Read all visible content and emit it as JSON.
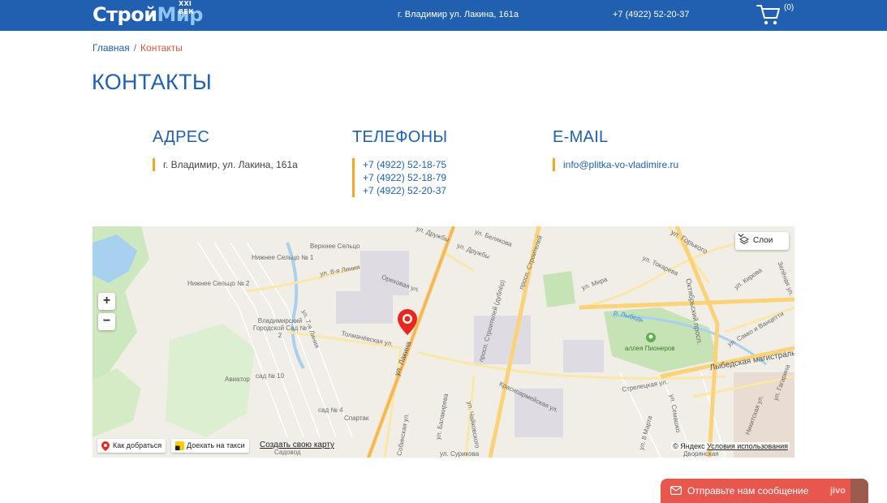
{
  "header": {
    "logo_part1": "Строй",
    "logo_part2": "Мир",
    "logo_sup": "XXI ВЕК",
    "address": "г. Владимир ул. Лакина, 161а",
    "phone": "+7 (4922) 52-20-37",
    "cart_count": "(0)"
  },
  "breadcrumb": {
    "home": "Главная",
    "separator": "/",
    "current": "Контакты"
  },
  "page_title": "КОНТАКТЫ",
  "contacts": {
    "address": {
      "title": "АДРЕС",
      "text": "г. Владимир,  ул. Лакина, 161а"
    },
    "phones": {
      "title": "ТЕЛЕФОНЫ",
      "items": [
        "+7 (4922) 52-18-75",
        "+7 (4922) 52-18-79",
        "+7 (4922) 52-20-37"
      ]
    },
    "email": {
      "title": "E-MAIL",
      "value": "info@plitka-vo-vladimire.ru"
    }
  },
  "map": {
    "layers_label": "Слои",
    "route_label": "Как добраться",
    "taxi_label": "Доехать на такси",
    "create_map_label": "Создать свою карту",
    "copyright": "© Яндекс",
    "terms": "Условия использования",
    "zoom_in": "+",
    "zoom_out": "−",
    "labels": {
      "verkhnee": "Верхнее Сельцо",
      "nizhnee1": "Нижнее Сельцо № 1",
      "nizhnee2": "Нижнее Сельцо № 2",
      "liniya8": "ул. 8-я Линия",
      "orekhovaya": "Ореховая ул.",
      "druzhby1": "ул. Дружбы",
      "druzhby2": "ул. Дружбы",
      "belyakova": "ул. Белякова",
      "stroiteley": "просп. Строителей",
      "stroiteley_dubler": "просп. Строителей (дублёр)",
      "gorkogo": "ул. Горького",
      "tokareva": "ул. Токарева",
      "oktyabrsky": "Октябрьский просп.",
      "kirova": "ул. Кирова",
      "zelenaya": "Зелёная ул.",
      "mira": "ул. Мира",
      "lybed": "р. Лыбедь",
      "pionerov": "аллея Пионеров",
      "sakko": "ул. Сакко и Ванцетти",
      "lybedskaya": "Лыбедская магистраль",
      "gorodskoy": "Владимирский Городской Сад № 2",
      "liniya7": "ул. 7-я Линия",
      "tolmachevskaya": "Толмачёвская ул.",
      "lakina": "ул. Лакина",
      "aviator": "Авиатор",
      "sad10": "сад № 10",
      "sad4": "сад № 4",
      "spartak": "Спартак",
      "sadovod": "Садовод",
      "sobinskaya": "Собинская ул.",
      "balakireva": "ул. Балакирева",
      "chaykovskogo": "ул. Чайковского",
      "surikova": "ул. Сурикова",
      "krasnoarmeyskaya": "Красноармейская ул.",
      "streletskaya": "Стрелецкая ул.",
      "semashko": "ул. Семашко",
      "marta8": "ул. 8 Марта",
      "nikitskaya": "Никитская ул.",
      "gagarina": "ул. Гагарина",
      "dvoryanskaya": "Дворянская"
    }
  },
  "chat": {
    "label": "Отправьте нам сообщение",
    "brand": "jivo"
  },
  "colors": {
    "brand_blue": "#2160b0",
    "accent_orange": "#f5a623",
    "breadcrumb_red": "#e2533f",
    "chat_red": "#e8574d"
  }
}
